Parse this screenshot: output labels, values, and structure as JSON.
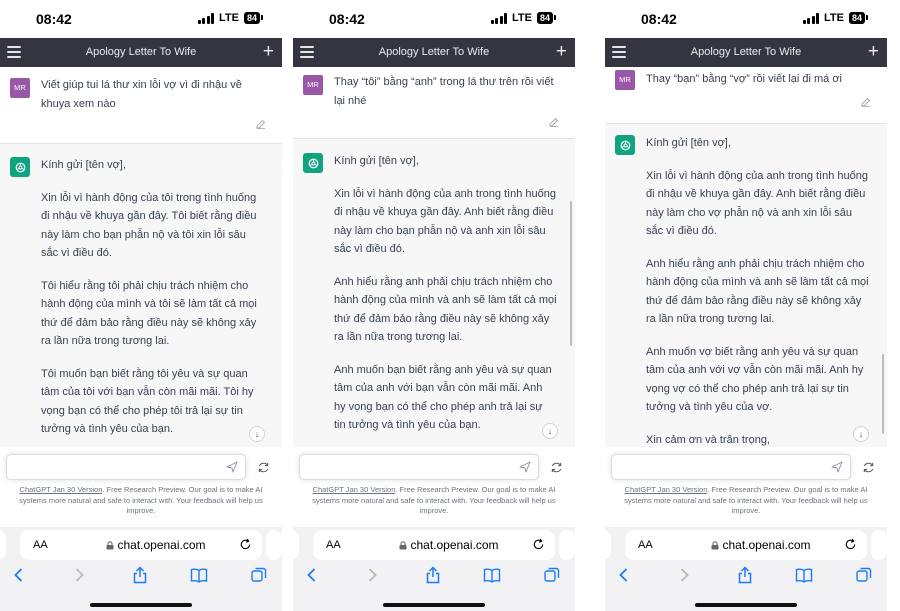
{
  "status": {
    "time": "08:42",
    "network": "LTE",
    "battery": "84"
  },
  "header": {
    "title": "Apology Letter To Wife"
  },
  "avatars": {
    "user": "MR"
  },
  "icons": {
    "menu": "hamburger-icon",
    "new_chat": "plus-icon",
    "edit": "pencil-icon",
    "send": "paper-plane-icon",
    "regenerate": "refresh-icon",
    "scroll_down": "arrow-down-icon",
    "bot": "openai-logo-icon",
    "lock": "lock-icon",
    "reload": "reload-icon"
  },
  "colors": {
    "topbar": "#343541",
    "bot": "#10a37f",
    "user_avatar": "#9a57a7",
    "assistant_bg": "#f7f7f8"
  },
  "composer": {
    "placeholder": ""
  },
  "footer": {
    "link": "ChatGPT Jan 30 Version",
    "text": ". Free Research Preview. Our goal is to make AI systems more natural and safe to interact with. Your feedback will help us improve."
  },
  "browser": {
    "aa": "AA",
    "url": "chat.openai.com"
  },
  "screens": [
    {
      "user_message": "Viết giúp tui lá thư xin lỗi vợ vì đi nhậu về khuya xem nào",
      "paragraphs": [
        "Kính gửi [tên vợ],",
        "Xin lỗi vì hành động của tôi trong tình huống đi nhậu về khuya gần đây. Tôi biết rằng điều này làm cho bạn phẫn nộ và tôi xin lỗi sâu sắc vì điều đó.",
        "Tôi hiểu rằng tôi phải chịu trách nhiệm cho hành động của mình và tôi sẽ làm tất cả mọi thứ để đảm bảo rằng điều này sẽ không xảy ra lần nữa trong tương lai.",
        "Tôi muốn bạn biết rằng tôi yêu và sự quan tâm của tôi với bạn vẫn còn mãi mãi. Tôi hy vọng bạn có thể cho phép tôi trả lại sự tin tưởng và tình yêu của bạn."
      ]
    },
    {
      "user_message": "Thay “tôi” bằng “anh” trong lá thư trên rồi viết lại nhé",
      "paragraphs": [
        "Kính gửi [tên vợ],",
        "Xin lỗi vì hành động của anh trong tình huống đi nhậu về khuya gần đây. Anh biết rằng điều này làm cho bạn phẫn nộ và anh xin lỗi sâu sắc vì điều đó.",
        "Anh hiểu rằng anh phải chịu trách nhiệm cho hành động của mình và anh sẽ làm tất cả mọi thứ để đảm bảo rằng điều này sẽ không xảy ra lần nữa trong tương lai.",
        "Anh muốn bạn biết rằng anh yêu và sự quan tâm của anh với bạn vẫn còn mãi mãi. Anh hy vọng bạn có thể cho phép anh trả lại sự tin tưởng và tình yêu của bạn."
      ]
    },
    {
      "user_message": "Thay “bạn” bằng “vợ” rồi viết lại đi má ơi",
      "paragraphs": [
        "Kính gửi [tên vợ],",
        "Xin lỗi vì hành động của anh trong tình huống đi nhậu về khuya gần đây. Anh biết rằng điều này làm cho vợ phẫn nộ và anh xin lỗi sâu sắc vì điều đó.",
        "Anh hiểu rằng anh phải chịu trách nhiệm cho hành động của mình và anh sẽ làm tất cả mọi thứ để đảm bảo rằng điều này sẽ không xảy ra lần nữa trong tương lai.",
        "Anh muốn vợ biết rằng anh yêu và sự quan tâm của anh với vợ vẫn còn mãi mãi. Anh hy vọng vợ có thể cho phép anh trả lại sự tin tưởng và tình yêu của vợ.",
        "Xin cảm ơn và trân trọng,"
      ]
    }
  ]
}
